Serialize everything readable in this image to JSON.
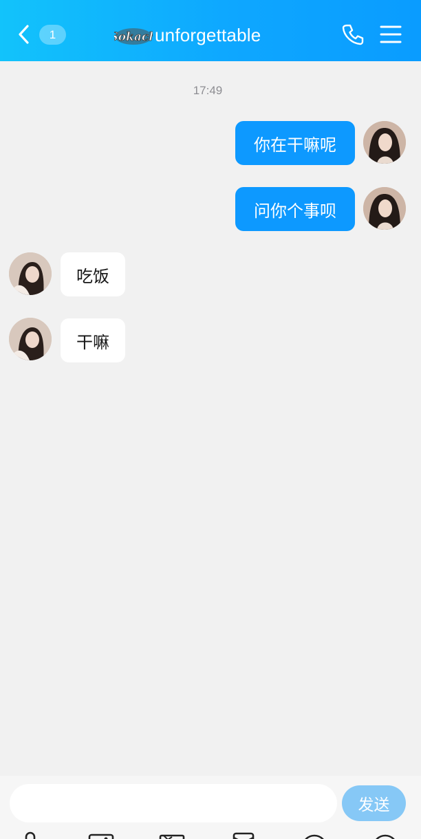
{
  "header": {
    "back_icon": "chevron-left-icon",
    "unread_count": "1",
    "logo_text": "Sokach",
    "contact_name": "unforgettable",
    "call_icon": "phone-icon",
    "menu_icon": "menu-icon",
    "background_color": "#0ea7ff"
  },
  "chat": {
    "timestamp": "17:49",
    "messages": [
      {
        "direction": "outgoing",
        "text": "你在干嘛呢"
      },
      {
        "direction": "outgoing",
        "text": "问你个事呗"
      },
      {
        "direction": "incoming",
        "text": "吃饭"
      },
      {
        "direction": "incoming",
        "text": "干嘛"
      }
    ],
    "outgoing_bubble_color": "#0d99ff",
    "incoming_bubble_color": "#ffffff"
  },
  "composer": {
    "input_value": "",
    "send_label": "发送",
    "send_color": "#86c8f6"
  },
  "toolbar": {
    "icons": [
      "microphone-icon",
      "image-icon",
      "camera-icon",
      "red-packet-icon",
      "emoji-icon",
      "plus-icon"
    ]
  }
}
